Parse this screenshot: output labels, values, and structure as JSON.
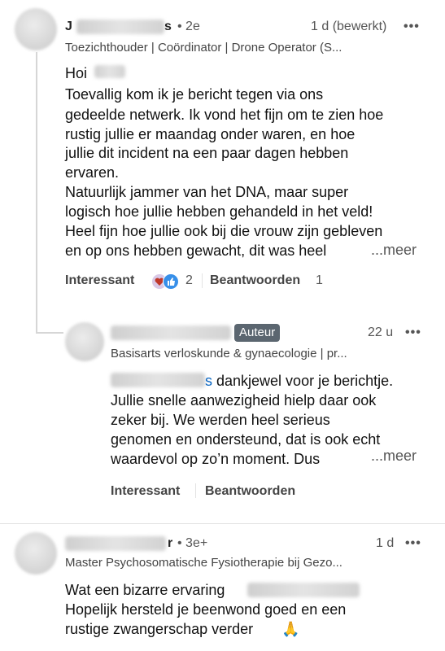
{
  "comment1": {
    "author_fragment": "J",
    "author_suffix": "s",
    "connection": "• 2e",
    "time": "1 d (bewerkt)",
    "more_options": "•••",
    "headline": "Toezichthouder | Coördinator | Drone Operator (S...",
    "greeting": "Hoi",
    "body_lines": [
      "Toevallig kom ik je bericht tegen via ons",
      "gedeelde netwerk. Ik vond het fijn om te zien hoe",
      "rustig jullie er maandag onder waren, en hoe",
      "jullie dit incident na een paar dagen hebben",
      "ervaren.",
      "Natuurlijk jammer van het DNA, maar super",
      "logisch hoe jullie hebben gehandeld in het veld!",
      "Heel fijn hoe jullie ook bij die vrouw zijn gebleven",
      "en op ons hebben gewacht, dit was heel"
    ],
    "see_more": "...meer",
    "reaction_label": "Interessant",
    "reaction_count": "2",
    "reply_label": "Beantwoorden",
    "reply_count": "1",
    "reaction_icons": [
      "love-icon",
      "like-icon"
    ]
  },
  "reply1": {
    "badge": "Auteur",
    "time": "22 u",
    "more_options": "•••",
    "headline": "Basisarts verloskunde & gynaecologie | pr...",
    "mention_suffix": "s",
    "body_first": "dankjewel voor je berichtje.",
    "body_lines": [
      "Jullie snelle aanwezigheid hielp daar ook",
      "zeker bij. We werden heel serieus",
      "genomen en ondersteund, dat is ook echt",
      "waardevol op zo’n moment. Dus"
    ],
    "see_more": "...meer",
    "reaction_label": "Interessant",
    "reply_label": "Beantwoorden"
  },
  "comment2": {
    "author_suffix": "r",
    "connection": "• 3e+",
    "time": "1 d",
    "more_options": "•••",
    "headline": "Master Psychosomatische Fysiotherapie bij Gezo...",
    "body_first": "Wat een bizarre ervaring",
    "body_lines": [
      "Hopelijk hersteld je beenwond goed en een",
      "rustige zwangerschap verder"
    ],
    "emoji": "🙏"
  },
  "colors": {
    "badge_bg": "#5b6670",
    "text": "#111111",
    "secondary": "#555555",
    "link_mention": "#0a66c2"
  }
}
